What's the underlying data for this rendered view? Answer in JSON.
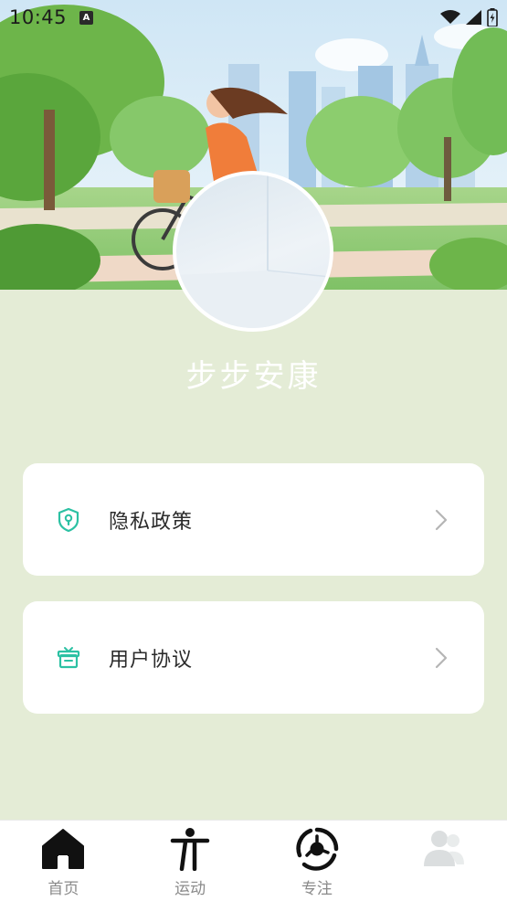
{
  "status_bar": {
    "time": "10:45",
    "notification_badge": "A",
    "icons": [
      "wifi-icon",
      "cellular-signal-icon",
      "battery-charging-icon"
    ]
  },
  "profile": {
    "app_name": "步步安康"
  },
  "menu": {
    "items": [
      {
        "label": "隐私政策",
        "icon": "shield-keyhole-icon"
      },
      {
        "label": "用户协议",
        "icon": "gift-box-icon"
      }
    ]
  },
  "bottom_nav": {
    "items": [
      {
        "label": "首页",
        "icon": "home-icon"
      },
      {
        "label": "运动",
        "icon": "exercise-person-icon"
      },
      {
        "label": "专注",
        "icon": "focus-target-icon"
      },
      {
        "label": "",
        "icon": "profile-users-icon",
        "active": true
      }
    ]
  },
  "colors": {
    "page_background": "#e4ecd6",
    "accent_teal": "#2cc1a3",
    "card_background": "#ffffff",
    "nav_label": "#8a8a8a"
  }
}
